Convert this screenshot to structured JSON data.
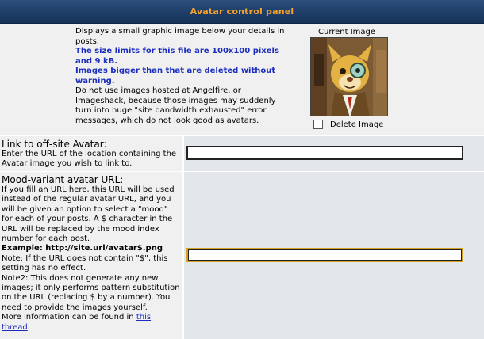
{
  "panel": {
    "title": "Avatar control panel"
  },
  "avatar_section": {
    "line1": "Displays a small graphic image below your details in posts.",
    "limits": "The size limits for this file are 100x100 pixels and 9 kB.",
    "warning": "Images bigger than that are deleted without warning.",
    "note": "Do not use images hosted at Angelfire, or Imageshack, because those images may suddenly turn into huge \"site bandwidth exhausted\" error messages, which do not look good as avatars.",
    "current_image_label": "Current Image",
    "delete_label": "Delete Image",
    "delete_checked": false
  },
  "offsite": {
    "title": "Link to off-site Avatar:",
    "description": "Enter the URL of the location containing the Avatar image you wish to link to.",
    "value": ""
  },
  "mood": {
    "title": "Mood-variant avatar URL:",
    "desc1": "If you fill an URL here, this URL will be used instead of the regular avatar URL, and you will be given an option to select a \"mood\" for each of your posts. A $ character in the URL will be replaced by the mood index number for each post.",
    "example": "Example: http://site.url/avatar$.png",
    "note1": "Note: If the URL does not contain \"$\", this setting has no effect.",
    "note2": "Note2: This does not generate any new images; it only performs pattern substitution on the URL (replacing $ by a number). You need to provide the images yourself.",
    "more_info_prefix": "More information can be found in ",
    "link_text": "this thread",
    "link_suffix": ".",
    "value": ""
  },
  "colors": {
    "header_bg": "#1f3f6a",
    "header_text": "#f7a42a",
    "emphasis_blue": "#1a2dbd",
    "row_light": "#f0f0f0",
    "row_alt": "#e3e6ea"
  }
}
